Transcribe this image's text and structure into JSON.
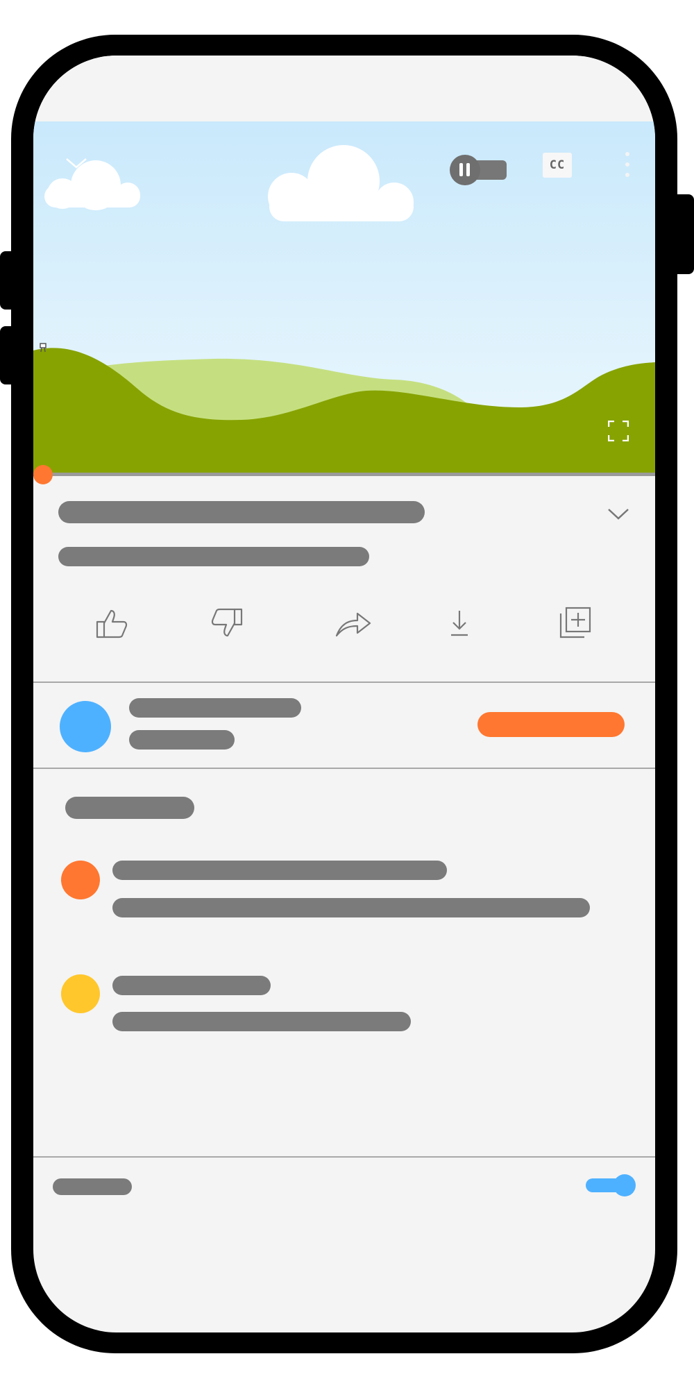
{
  "app": {
    "title": "",
    "colors": {
      "accent": "#ff7730",
      "channel_avatar": "#4eb1ff",
      "commenter_1": "#ff7730",
      "commenter_2": "#ffc72c",
      "toggle": "#4eb1ff",
      "skeleton": "#7b7b7b"
    }
  },
  "player": {
    "state": "playing",
    "progress_fraction": 0.0,
    "captions_label": "CC",
    "icons": [
      "minimize-icon",
      "pause-icon",
      "captions-icon",
      "more-vert-icon",
      "fullscreen-icon"
    ]
  },
  "actions": {
    "icons": [
      "thumbs-up-icon",
      "thumbs-down-icon",
      "share-icon",
      "download-icon",
      "save-to-playlist-icon"
    ]
  },
  "channel": {
    "subscribe_label": ""
  },
  "footer": {
    "autoplay_on": true
  }
}
